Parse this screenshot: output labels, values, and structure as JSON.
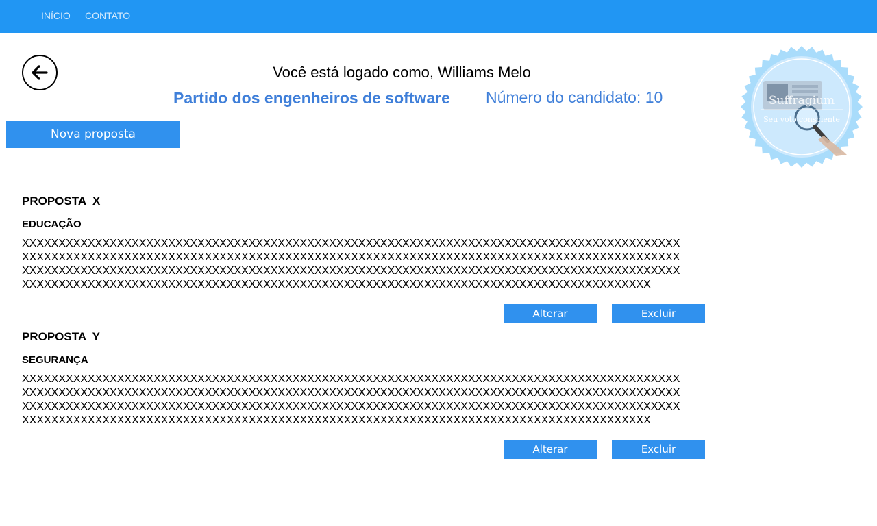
{
  "nav": {
    "items": [
      {
        "label": "INÍCIO"
      },
      {
        "label": "CONTATO"
      }
    ]
  },
  "header": {
    "greeting": "Você está logado como, Williams Melo",
    "party": "Partido dos engenheiros de software",
    "candidate_number": "Número do candidato: 10"
  },
  "actions": {
    "new_proposal": "Nova proposta"
  },
  "logo": {
    "brand": "Suffragium",
    "tagline": "Seu voto consciente"
  },
  "proposals": [
    {
      "title": "PROPOSTA  X",
      "category": "EDUCAÇÃO",
      "text": "XXXXXXXXXXXXXXXXXXXXXXXXXXXXXXXXXXXXXXXXXXXXXXXXXXXXXXXXXXXXXXXXXXXXXXXXXXXXXXXXXXXXXXXXXXXXXXXXXXXXXXXXXXXXXXXXXXXXXXXXXXXXXXXXXXXXXXXXXXXXXXXXXXXXXXXXXXXXXXXXXXXXXXXXXXXXXXXXXXXXXXXXXXXXXXXXXXXXXXXXXXXXXXXXXXXXXXXXXXXXXXXXXXXXXXXXXXXXXXXXXXXXXXXXXXXXXXXXXXXXXXXXXXXXXXXXXXXXXXXXXXXXXXXXXXXXXXXXXXXXXXXXXXXXXXXXXXXXXXXXXXXXXXXXXXXXXXXXXXXXXXXXXXXXXXXXXXXX",
      "edit_label": "Alterar",
      "delete_label": "Excluir"
    },
    {
      "title": "PROPOSTA  Y",
      "category": "SEGURANÇA",
      "text": "XXXXXXXXXXXXXXXXXXXXXXXXXXXXXXXXXXXXXXXXXXXXXXXXXXXXXXXXXXXXXXXXXXXXXXXXXXXXXXXXXXXXXXXXXXXXXXXXXXXXXXXXXXXXXXXXXXXXXXXXXXXXXXXXXXXXXXXXXXXXXXXXXXXXXXXXXXXXXXXXXXXXXXXXXXXXXXXXXXXXXXXXXXXXXXXXXXXXXXXXXXXXXXXXXXXXXXXXXXXXXXXXXXXXXXXXXXXXXXXXXXXXXXXXXXXXXXXXXXXXXXXXXXXXXXXXXXXXXXXXXXXXXXXXXXXXXXXXXXXXXXXXXXXXXXXXXXXXXXXXXXXXXXXXXXXXXXXXXXXXXXXXXXXXXXXXXXXX",
      "edit_label": "Alterar",
      "delete_label": "Excluir"
    }
  ]
}
